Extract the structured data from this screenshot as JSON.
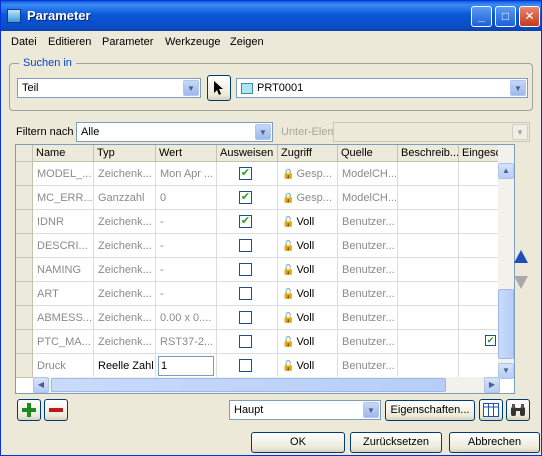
{
  "window": {
    "title": "Parameter"
  },
  "menu": [
    "Datei",
    "Editieren",
    "Parameter",
    "Werkzeuge",
    "Zeigen"
  ],
  "search": {
    "group_label": "Suchen in",
    "scope_value": "Teil",
    "model_value": "PRT0001"
  },
  "filter": {
    "label": "Filtern nach",
    "value": "Alle",
    "sub_label": "Unter-Elem",
    "sub_value": ""
  },
  "table": {
    "columns": [
      "Name",
      "Typ",
      "Wert",
      "Ausweisen",
      "Zugriff",
      "Quelle",
      "Beschreib...",
      "Eingeschr"
    ],
    "rows": [
      {
        "name": "MODEL_...",
        "type": "Zeichenk...",
        "value": "Mon Apr ...",
        "designate": true,
        "access": "Gesp...",
        "source": "ModelCH...",
        "dark": false
      },
      {
        "name": "MC_ERR...",
        "type": "Ganzzahl",
        "value": "0",
        "designate": true,
        "access": "Gesp...",
        "source": "ModelCH...",
        "dark": false
      },
      {
        "name": "IDNR",
        "type": "Zeichenk...",
        "value": "-",
        "designate": true,
        "access": "Voll",
        "source": "Benutzer...",
        "dark": false
      },
      {
        "name": "DESCRI...",
        "type": "Zeichenk...",
        "value": "-",
        "designate": false,
        "access": "Voll",
        "source": "Benutzer...",
        "dark": false
      },
      {
        "name": "NAMING",
        "type": "Zeichenk...",
        "value": "-",
        "designate": false,
        "access": "Voll",
        "source": "Benutzer...",
        "dark": false
      },
      {
        "name": "ART",
        "type": "Zeichenk...",
        "value": "-",
        "designate": false,
        "access": "Voll",
        "source": "Benutzer...",
        "dark": false
      },
      {
        "name": "ABMESS...",
        "type": "Zeichenk...",
        "value": "0.00 x 0....",
        "designate": false,
        "access": "Voll",
        "source": "Benutzer...",
        "dark": false
      },
      {
        "name": "PTC_MA...",
        "type": "Zeichenk...",
        "value": "RST37-2...",
        "designate": false,
        "access": "Voll",
        "source": "Benutzer...",
        "dark": false
      },
      {
        "name": "Druck",
        "type": "Reelle Zahl",
        "value": "1",
        "designate": false,
        "access": "Voll",
        "source": "Benutzer...",
        "dark": true
      }
    ]
  },
  "bottom": {
    "set_value": "Haupt",
    "properties_label": "Eigenschaften..."
  },
  "footer": {
    "ok_label": "OK",
    "reset_label": "Zurücksetzen",
    "cancel_label": "Abbrechen"
  }
}
